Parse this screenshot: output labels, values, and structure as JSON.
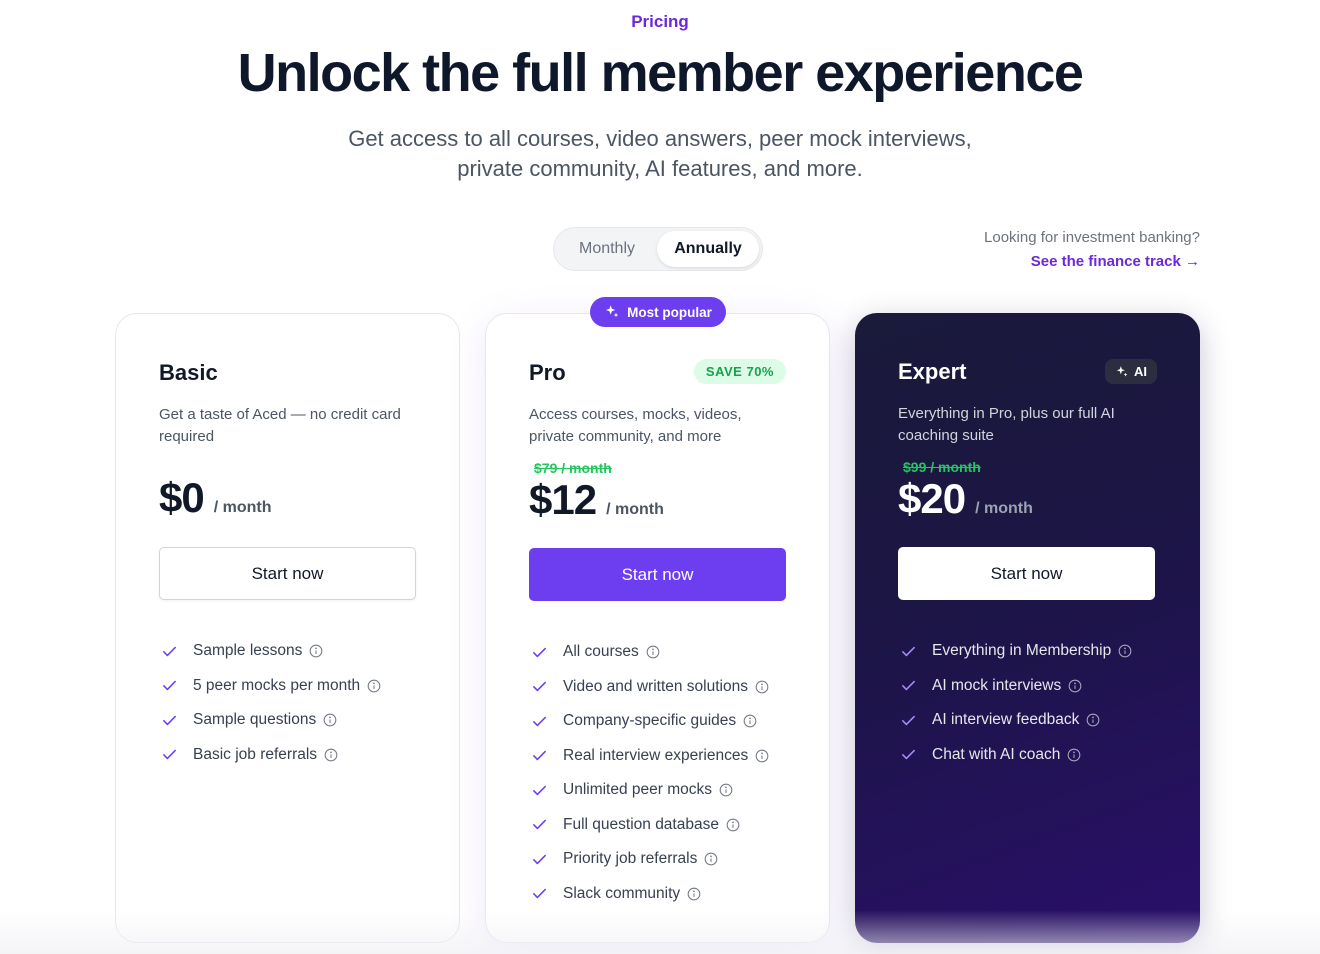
{
  "header": {
    "eyebrow": "Pricing",
    "title": "Unlock the full member experience",
    "subtitle_line1": "Get access to all courses, video answers, peer mock interviews,",
    "subtitle_line2": "private community, AI features, and more."
  },
  "billing_toggle": {
    "monthly_label": "Monthly",
    "annually_label": "Annually",
    "selected": "Annually"
  },
  "finance_link": {
    "question": "Looking for investment banking?",
    "link_text": "See the finance track →"
  },
  "plans": [
    {
      "name": "Basic",
      "desc": "Get a taste of Aced — no credit card required",
      "old_price": "",
      "price": "$0",
      "period": "/ month",
      "cta": "Start now",
      "features": [
        "Sample lessons",
        "5 peer mocks per month",
        "Sample questions",
        "Basic job referrals"
      ]
    },
    {
      "name": "Pro",
      "badge": "Most popular",
      "tag": "SAVE 70%",
      "desc": "Access courses, mocks, videos, private community, and more",
      "old_price": "$79 / month",
      "price": "$12",
      "period": "/ month",
      "cta": "Start now",
      "features": [
        "All courses",
        "Video and written solutions",
        "Company-specific guides",
        "Real interview experiences",
        "Unlimited peer mocks",
        "Full question database",
        "Priority job referrals",
        "Slack community"
      ]
    },
    {
      "name": "Expert",
      "tag": "AI",
      "desc": "Everything in Pro, plus our full AI coaching suite",
      "old_price": "$99 / month",
      "price": "$20",
      "period": "/ month",
      "cta": "Start now",
      "features": [
        "Everything in Membership",
        "AI mock interviews",
        "AI interview feedback",
        "Chat with AI coach"
      ]
    }
  ],
  "colors": {
    "accent": "#6d3ef0",
    "accent_text": "#6d28d9",
    "save_green": "#16a34a",
    "expert_bg_start": "#1a1a3a",
    "expert_bg_end": "#2a0f6b"
  },
  "icons": {
    "check": "check-icon",
    "info": "info-icon",
    "sparkle": "sparkle-icon"
  }
}
